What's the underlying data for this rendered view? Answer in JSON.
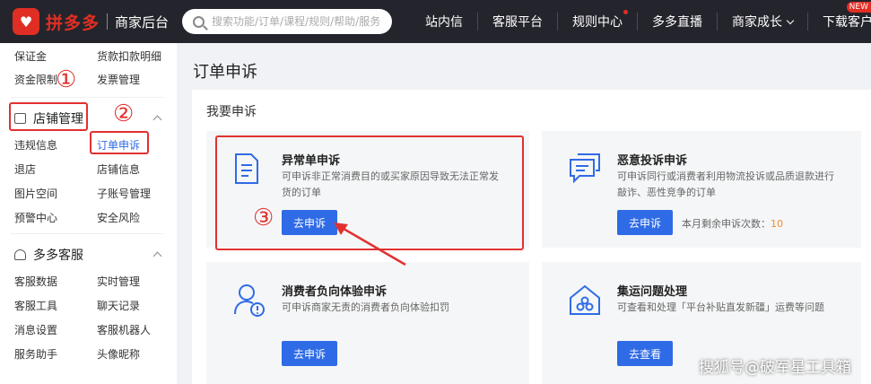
{
  "header": {
    "logo_mark": "♥",
    "logo_text": "拼多多",
    "logo_sub": "商家后台",
    "search_placeholder": "搜索功能/订单/课程/规则/帮助/服务",
    "nav": [
      "站内信",
      "客服平台",
      "规则中心",
      "多多直播",
      "商家成长",
      "下载客户端"
    ],
    "new_badge": "NEW"
  },
  "sidebar": {
    "top_rows": [
      [
        "保证金",
        "货款扣款明细"
      ],
      [
        "资金限制",
        "发票管理"
      ]
    ],
    "store_section": "店铺管理",
    "store_rows": [
      [
        "违规信息",
        "订单申诉"
      ],
      [
        "退店",
        "店铺信息"
      ],
      [
        "图片空间",
        "子账号管理"
      ],
      [
        "预警中心",
        "安全风险"
      ]
    ],
    "service_section": "多多客服",
    "service_rows": [
      [
        "客服数据",
        "实时管理"
      ],
      [
        "客服工具",
        "聊天记录"
      ],
      [
        "消息设置",
        "客服机器人"
      ],
      [
        "服务助手",
        "头像昵称"
      ]
    ]
  },
  "main": {
    "page_title": "订单申诉",
    "panel_title": "我要申诉",
    "cards": [
      {
        "title": "异常单申诉",
        "desc": [
          "可申诉非正常消费目的或买家原因导致无法正常发",
          "货的订单"
        ],
        "button": "去申诉"
      },
      {
        "title": "恶意投诉申诉",
        "desc": [
          "可申诉同行或消费者利用物流投诉或品质退款进行",
          "敲诈、恶性竞争的订单"
        ],
        "button": "去申诉",
        "remain_label": "本月剩余申诉次数：",
        "remain_value": "10"
      },
      {
        "title": "消费者负向体验申诉",
        "desc": [
          "可申诉商家无责的消费者负向体验扣罚"
        ],
        "button": "去申诉"
      },
      {
        "title": "集运问题处理",
        "desc": [
          "可查看和处理「平台补贴直发新疆」运费等问题"
        ],
        "button": "去查看"
      }
    ]
  },
  "annotations": {
    "n1": "①",
    "n2": "②",
    "n3": "③"
  },
  "watermark": "搜狐号@破军星工具箱",
  "colors": {
    "header_bg": "#24252c",
    "brand_red": "#e02e24",
    "primary_blue": "#2f6be6",
    "annotation_red": "#e03131"
  }
}
